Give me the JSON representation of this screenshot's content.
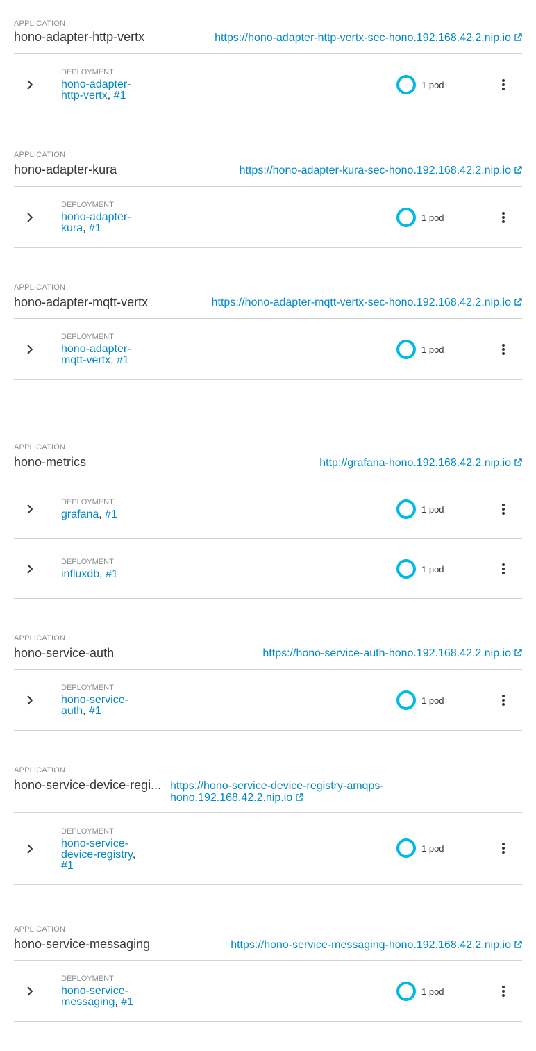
{
  "app_label": "APPLICATION",
  "deploy_label": "DEPLOYMENT",
  "applications": [
    {
      "name": "hono-adapter-http-vertx",
      "route": "https://hono-adapter-http-vertx-sec-hono.192.168.42.2.nip.io",
      "deployments": [
        {
          "name_line1": "hono-adapter-",
          "name_line2": "http-vertx",
          "revision": "#1",
          "pods": "1 pod"
        }
      ]
    },
    {
      "name": "hono-adapter-kura",
      "route": "https://hono-adapter-kura-sec-hono.192.168.42.2.nip.io",
      "deployments": [
        {
          "name_line1": "hono-adapter-",
          "name_line2": "kura",
          "revision": "#1",
          "pods": "1 pod"
        }
      ]
    },
    {
      "name": "hono-adapter-mqtt-vertx",
      "route": "https://hono-adapter-mqtt-vertx-sec-hono.192.168.42.2.nip.io",
      "deployments": [
        {
          "name_line1": "hono-adapter-",
          "name_line2": "mqtt-vertx",
          "revision": "#1",
          "pods": "1 pod"
        }
      ]
    },
    {
      "name": "hono-metrics",
      "route": "http://grafana-hono.192.168.42.2.nip.io",
      "deployments": [
        {
          "name_line1": "grafana",
          "revision": "#1",
          "pods": "1 pod"
        },
        {
          "name_line1": "influxdb",
          "revision": "#1",
          "pods": "1 pod"
        }
      ]
    },
    {
      "name": "hono-service-auth",
      "route": "https://hono-service-auth-hono.192.168.42.2.nip.io",
      "deployments": [
        {
          "name_line1": "hono-service-",
          "name_line2": "auth",
          "revision": "#1",
          "pods": "1 pod"
        }
      ]
    },
    {
      "name": "hono-service-device-regi...",
      "route_line1": "https://hono-service-device-registry-amqps-",
      "route_line2": "hono.192.168.42.2.nip.io",
      "deployments": [
        {
          "name_line1": "hono-service-",
          "name_line2": "device-registry",
          "revision": "#1",
          "pods": "1 pod"
        }
      ]
    },
    {
      "name": "hono-service-messaging",
      "route": "https://hono-service-messaging-hono.192.168.42.2.nip.io",
      "deployments": [
        {
          "name_line1": "hono-service-",
          "name_line2": "messaging",
          "revision": "#1",
          "pods": "1 pod"
        }
      ]
    }
  ],
  "colors": {
    "link": "#0088ce",
    "donut": "#00b9e4",
    "divider": "#d1d1d1"
  }
}
